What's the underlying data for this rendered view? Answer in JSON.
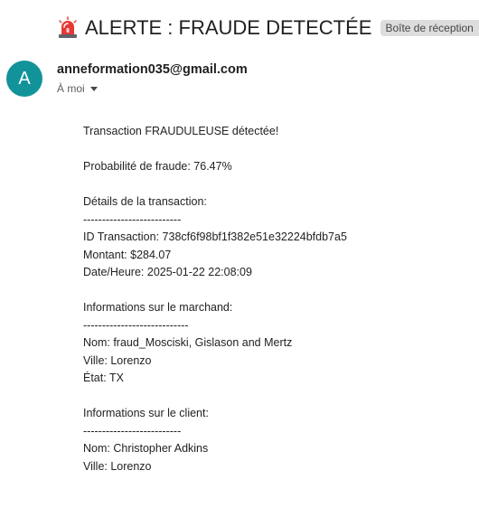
{
  "subject": {
    "icon": "siren-icon",
    "text": "ALERTE : FRAUDE DETECTÉE",
    "label": "Boîte de réception",
    "label_close": "×"
  },
  "sender": {
    "avatar_letter": "A",
    "avatar_color": "#12939a",
    "email": "anneformation035@gmail.com",
    "recipient": "À moi"
  },
  "body": {
    "lines": [
      "Transaction FRAUDULEUSE détectée!",
      "",
      "Probabilité de fraude: 76.47%",
      "",
      "Détails de la transaction:",
      "--------------------------",
      "ID Transaction: 738cf6f98bf1f382e51e32224bfdb7a5",
      "Montant: $284.07",
      "Date/Heure: 2025-01-22 22:08:09",
      "",
      "Informations sur le marchand:",
      "----------------------------",
      "Nom: fraud_Mosciski, Gislason and Mertz",
      "Ville: Lorenzo",
      "État: TX",
      "",
      "Informations sur le client:",
      "--------------------------",
      "Nom: Christopher Adkins",
      "Ville: Lorenzo"
    ]
  }
}
